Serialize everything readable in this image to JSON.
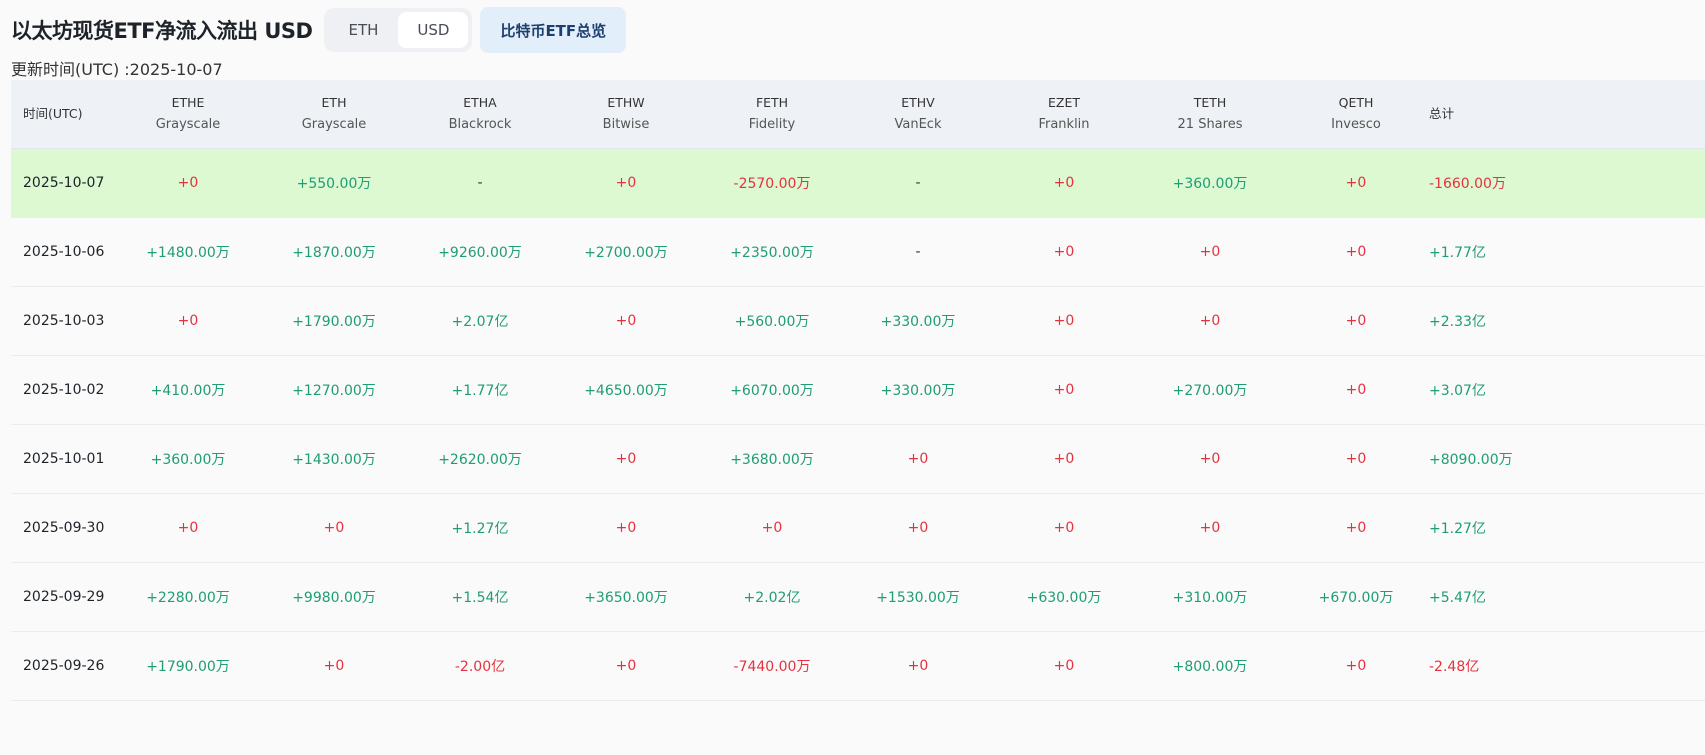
{
  "title": "以太坊现货ETF净流入流出 USD",
  "toggle": {
    "eth": "ETH",
    "usd": "USD",
    "active": "USD"
  },
  "btc_button": "比特币ETF总览",
  "updated": "更新时间(UTC) :2025-10-07",
  "colors": {
    "positive": "#1f9d74",
    "negative": "#e5323f",
    "highlight": "#dcf9d2"
  },
  "table": {
    "date_header": "时间(UTC)",
    "columns": [
      {
        "ticker": "ETHE",
        "issuer": "Grayscale"
      },
      {
        "ticker": "ETH",
        "issuer": "Grayscale"
      },
      {
        "ticker": "ETHA",
        "issuer": "Blackrock"
      },
      {
        "ticker": "ETHW",
        "issuer": "Bitwise"
      },
      {
        "ticker": "FETH",
        "issuer": "Fidelity"
      },
      {
        "ticker": "ETHV",
        "issuer": "VanEck"
      },
      {
        "ticker": "EZET",
        "issuer": "Franklin"
      },
      {
        "ticker": "TETH",
        "issuer": "21 Shares"
      },
      {
        "ticker": "QETH",
        "issuer": "Invesco"
      }
    ],
    "total_header": "总计",
    "rows": [
      {
        "date": "2025-10-07",
        "values": [
          "+0",
          "+550.00万",
          "-",
          "+0",
          "-2570.00万",
          "-",
          "+0",
          "+360.00万",
          "+0"
        ],
        "total": "-1660.00万"
      },
      {
        "date": "2025-10-06",
        "values": [
          "+1480.00万",
          "+1870.00万",
          "+9260.00万",
          "+2700.00万",
          "+2350.00万",
          "-",
          "+0",
          "+0",
          "+0"
        ],
        "total": "+1.77亿"
      },
      {
        "date": "2025-10-03",
        "values": [
          "+0",
          "+1790.00万",
          "+2.07亿",
          "+0",
          "+560.00万",
          "+330.00万",
          "+0",
          "+0",
          "+0"
        ],
        "total": "+2.33亿"
      },
      {
        "date": "2025-10-02",
        "values": [
          "+410.00万",
          "+1270.00万",
          "+1.77亿",
          "+4650.00万",
          "+6070.00万",
          "+330.00万",
          "+0",
          "+270.00万",
          "+0"
        ],
        "total": "+3.07亿"
      },
      {
        "date": "2025-10-01",
        "values": [
          "+360.00万",
          "+1430.00万",
          "+2620.00万",
          "+0",
          "+3680.00万",
          "+0",
          "+0",
          "+0",
          "+0"
        ],
        "total": "+8090.00万"
      },
      {
        "date": "2025-09-30",
        "values": [
          "+0",
          "+0",
          "+1.27亿",
          "+0",
          "+0",
          "+0",
          "+0",
          "+0",
          "+0"
        ],
        "total": "+1.27亿"
      },
      {
        "date": "2025-09-29",
        "values": [
          "+2280.00万",
          "+9980.00万",
          "+1.54亿",
          "+3650.00万",
          "+2.02亿",
          "+1530.00万",
          "+630.00万",
          "+310.00万",
          "+670.00万"
        ],
        "total": "+5.47亿"
      },
      {
        "date": "2025-09-26",
        "values": [
          "+1790.00万",
          "+0",
          "-2.00亿",
          "+0",
          "-7440.00万",
          "+0",
          "+0",
          "+800.00万",
          "+0"
        ],
        "total": "-2.48亿"
      }
    ]
  }
}
